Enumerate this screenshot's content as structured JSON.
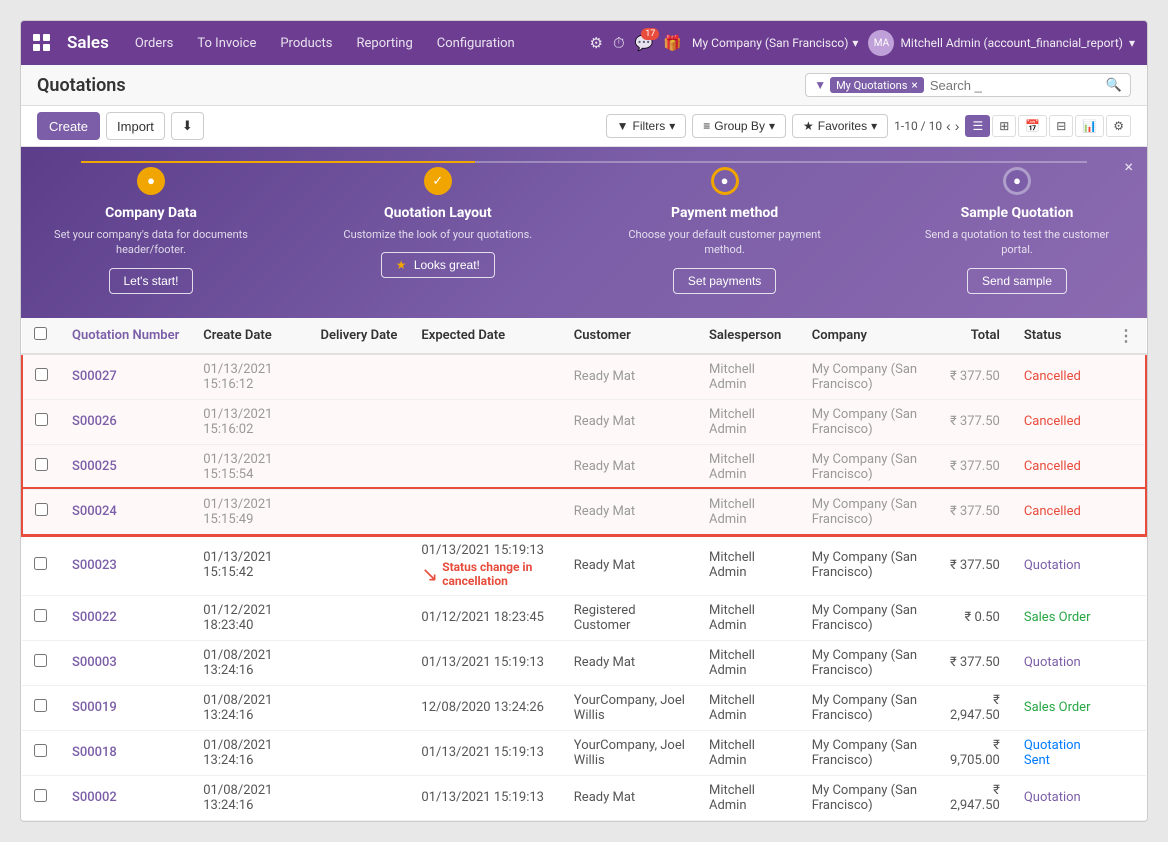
{
  "app": {
    "title": "Sales",
    "nav_links": [
      "Orders",
      "To Invoice",
      "Products",
      "Reporting",
      "Configuration"
    ],
    "company": "My Company (San Francisco)",
    "user": "Mitchell Admin (account_financial_report)",
    "chat_count": "17"
  },
  "page": {
    "title": "Quotations"
  },
  "toolbar": {
    "create_label": "Create",
    "import_label": "Import",
    "filters_label": "Filters",
    "group_by_label": "Group By",
    "favorites_label": "Favorites",
    "pagination": "1-10 / 10",
    "search_placeholder": "Search _",
    "filter_tag": "My Quotations"
  },
  "banner": {
    "close_label": "×",
    "steps": [
      {
        "id": "company-data",
        "circle": "●",
        "state": "done",
        "title": "Company Data",
        "desc": "Set your company's data for documents header/footer.",
        "action": "Let's start!"
      },
      {
        "id": "quotation-layout",
        "circle": "✓",
        "state": "done",
        "title": "Quotation Layout",
        "desc": "Customize the look of your quotations.",
        "action": "★ Looks great!",
        "star": true
      },
      {
        "id": "payment-method",
        "circle": "●",
        "state": "active",
        "title": "Payment method",
        "desc": "Choose your default customer payment method.",
        "action": "Set payments"
      },
      {
        "id": "sample-quotation",
        "circle": "●",
        "state": "pending",
        "title": "Sample Quotation",
        "desc": "Send a quotation to test the customer portal.",
        "action": "Send sample"
      }
    ]
  },
  "table": {
    "columns": [
      "Quotation Number",
      "Create Date",
      "Delivery Date",
      "Expected Date",
      "Customer",
      "Salesperson",
      "Company",
      "Total",
      "Status"
    ],
    "rows": [
      {
        "id": "S00027",
        "create_date": "01/13/2021 15:16:12",
        "delivery_date": "",
        "expected_date": "",
        "customer": "Ready Mat",
        "salesperson": "Mitchell Admin",
        "company": "My Company (San Francisco)",
        "total": "₹ 377.50",
        "status": "Cancelled",
        "cancelled": true
      },
      {
        "id": "S00026",
        "create_date": "01/13/2021 15:16:02",
        "delivery_date": "",
        "expected_date": "",
        "customer": "Ready Mat",
        "salesperson": "Mitchell Admin",
        "company": "My Company (San Francisco)",
        "total": "₹ 377.50",
        "status": "Cancelled",
        "cancelled": true
      },
      {
        "id": "S00025",
        "create_date": "01/13/2021 15:15:54",
        "delivery_date": "",
        "expected_date": "",
        "customer": "Ready Mat",
        "salesperson": "Mitchell Admin",
        "company": "My Company (San Francisco)",
        "total": "₹ 377.50",
        "status": "Cancelled",
        "cancelled": true
      },
      {
        "id": "S00024",
        "create_date": "01/13/2021 15:15:49",
        "delivery_date": "",
        "expected_date": "",
        "customer": "Ready Mat",
        "salesperson": "Mitchell Admin",
        "company": "My Company (San Francisco)",
        "total": "₹ 377.50",
        "status": "Cancelled",
        "cancelled": true
      },
      {
        "id": "S00023",
        "create_date": "01/13/2021 15:15:42",
        "delivery_date": "",
        "expected_date": "01/13/2021 15:19:13",
        "customer": "Ready Mat",
        "salesperson": "Mitchell Admin",
        "company": "My Company (San Francisco)",
        "total": "₹ 377.50",
        "status": "Quotation",
        "cancelled": false,
        "annotation": "Status change in cancellation"
      },
      {
        "id": "S00022",
        "create_date": "01/12/2021 18:23:40",
        "delivery_date": "",
        "expected_date": "01/12/2021 18:23:45",
        "customer": "Registered Customer",
        "salesperson": "Mitchell Admin",
        "company": "My Company (San Francisco)",
        "total": "₹ 0.50",
        "status": "Sales Order",
        "cancelled": false
      },
      {
        "id": "S00003",
        "create_date": "01/08/2021 13:24:16",
        "delivery_date": "",
        "expected_date": "01/13/2021 15:19:13",
        "customer": "Ready Mat",
        "salesperson": "Mitchell Admin",
        "company": "My Company (San Francisco)",
        "total": "₹ 377.50",
        "status": "Quotation",
        "cancelled": false
      },
      {
        "id": "S00019",
        "create_date": "01/08/2021 13:24:16",
        "delivery_date": "",
        "expected_date": "12/08/2020 13:24:26",
        "customer": "YourCompany, Joel Willis",
        "salesperson": "Mitchell Admin",
        "company": "My Company (San Francisco)",
        "total": "₹ 2,947.50",
        "status": "Sales Order",
        "cancelled": false
      },
      {
        "id": "S00018",
        "create_date": "01/08/2021 13:24:16",
        "delivery_date": "",
        "expected_date": "01/13/2021 15:19:13",
        "customer": "YourCompany, Joel Willis",
        "salesperson": "Mitchell Admin",
        "company": "My Company (San Francisco)",
        "total": "₹ 9,705.00",
        "status": "Quotation Sent",
        "cancelled": false
      },
      {
        "id": "S00002",
        "create_date": "01/08/2021 13:24:16",
        "delivery_date": "",
        "expected_date": "01/13/2021 15:19:13",
        "customer": "Ready Mat",
        "salesperson": "Mitchell Admin",
        "company": "My Company (San Francisco)",
        "total": "₹ 2,947.50",
        "status": "Quotation",
        "cancelled": false
      }
    ]
  }
}
